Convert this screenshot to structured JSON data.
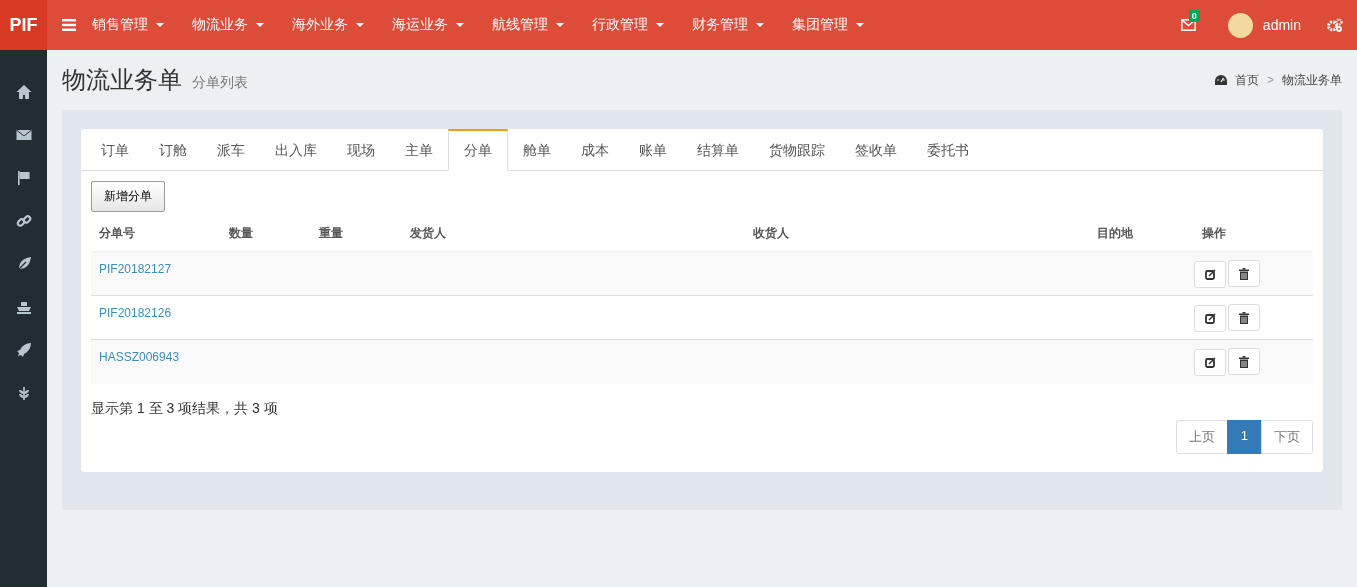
{
  "brand": "PIF",
  "nav": [
    {
      "label": "销售管理"
    },
    {
      "label": "物流业务"
    },
    {
      "label": "海外业务"
    },
    {
      "label": "海运业务"
    },
    {
      "label": "航线管理"
    },
    {
      "label": "行政管理"
    },
    {
      "label": "财务管理"
    },
    {
      "label": "集团管理"
    }
  ],
  "notifications": {
    "count": "0"
  },
  "user": {
    "name": "admin"
  },
  "page_header": {
    "title": "物流业务单",
    "subtitle": "分单列表"
  },
  "breadcrumb": [
    "首页",
    "物流业务单"
  ],
  "breadcrumb_separator": ">",
  "tabs": [
    {
      "label": "订单",
      "selected": false
    },
    {
      "label": "订舱",
      "selected": false
    },
    {
      "label": "派车",
      "selected": false
    },
    {
      "label": "出入库",
      "selected": false
    },
    {
      "label": "现场",
      "selected": false
    },
    {
      "label": "主单",
      "selected": false
    },
    {
      "label": "分单",
      "selected": true
    },
    {
      "label": "舱单",
      "selected": false
    },
    {
      "label": "成本",
      "selected": false
    },
    {
      "label": "账单",
      "selected": false
    },
    {
      "label": "结算单",
      "selected": false
    },
    {
      "label": "货物跟踪",
      "selected": false
    },
    {
      "label": "签收单",
      "selected": false
    },
    {
      "label": "委托书",
      "selected": false
    }
  ],
  "add_button": "新增分单",
  "table": {
    "columns": [
      "分单号",
      "数量",
      "重量",
      "发货人",
      "收货人",
      "目的地",
      "操作"
    ],
    "rows": [
      {
        "number": "PIF20182127"
      },
      {
        "number": "PIF20182126"
      },
      {
        "number": "HASSZ006943"
      }
    ]
  },
  "info": "显示第 1 至 3 项结果，共 3 项",
  "pagination": {
    "prev": "上页",
    "pages": [
      {
        "label": "1",
        "selected": true
      }
    ],
    "next": "下页"
  }
}
